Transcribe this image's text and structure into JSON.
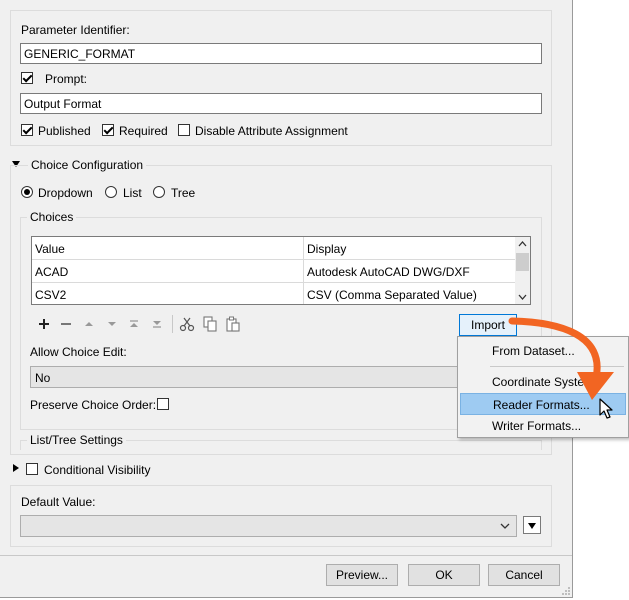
{
  "parameter": {
    "identifier_label": "Parameter Identifier:",
    "identifier_value": "GENERIC_FORMAT",
    "prompt_label": "Prompt:",
    "prompt_value": "Output Format",
    "published_label": "Published",
    "required_label": "Required",
    "disable_attr_label": "Disable Attribute Assignment"
  },
  "choice_config": {
    "section_label": "Choice Configuration",
    "radios": [
      "Dropdown",
      "List",
      "Tree"
    ],
    "selected": "Dropdown",
    "choices_group_label": "Choices",
    "table": {
      "headers": [
        "Value",
        "Display"
      ],
      "rows": [
        {
          "value": "ACAD",
          "display": "Autodesk AutoCAD DWG/DXF"
        },
        {
          "value": "CSV2",
          "display": "CSV (Comma Separated Value)"
        }
      ]
    },
    "import_label": "Import",
    "allow_edit_label": "Allow Choice Edit:",
    "allow_edit_value": "No",
    "preserve_order_label": "Preserve Choice Order:",
    "list_tree_label": "List/Tree Settings"
  },
  "conditional_visibility_label": "Conditional Visibility",
  "default_value_label": "Default Value:",
  "import_menu": {
    "items": [
      "From Dataset...",
      "Coordinate Syste",
      "Reader Formats...",
      "Writer Formats..."
    ],
    "highlighted": "Reader Formats..."
  },
  "footer": {
    "preview": "Preview...",
    "ok": "OK",
    "cancel": "Cancel"
  },
  "colors": {
    "arrow": "#f26522",
    "menu_highlight": "#9ecbf2",
    "dialog_bg": "#f0f0f0"
  }
}
